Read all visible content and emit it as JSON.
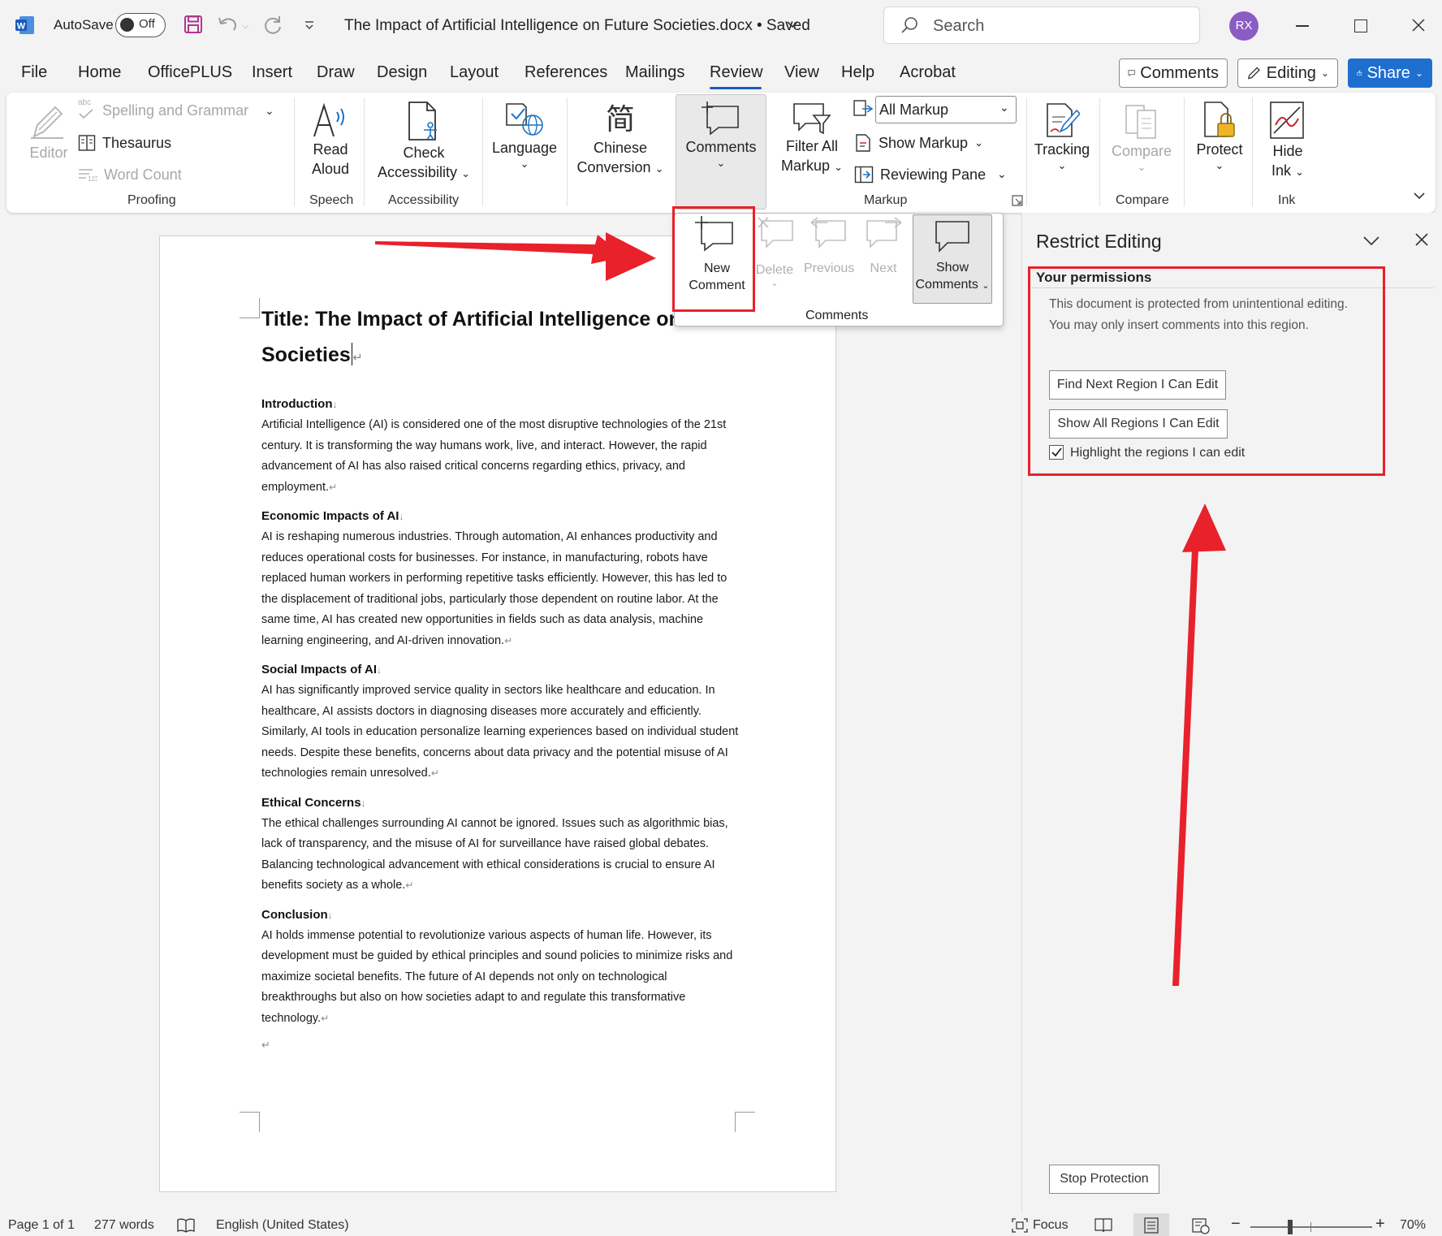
{
  "titlebar": {
    "autosave_label": "AutoSave",
    "autosave_state": "Off",
    "doc_title": "The Impact of Artificial Intelligence on Future Societies.docx • Saved",
    "search_placeholder": "Search",
    "avatar_initials": "RX"
  },
  "menu": {
    "tabs": [
      "File",
      "Home",
      "OfficePLUS",
      "Insert",
      "Draw",
      "Design",
      "Layout",
      "References",
      "Mailings",
      "Review",
      "View",
      "Help",
      "Acrobat"
    ],
    "active_tab": "Review",
    "comments_btn": "Comments",
    "editing_btn": "Editing",
    "share_btn": "Share"
  },
  "ribbon": {
    "editor": "Editor",
    "spelling": "Spelling and Grammar",
    "spelling_abc": "abc",
    "thesaurus": "Thesaurus",
    "word_count": "Word Count",
    "proofing": "Proofing",
    "read": "Read",
    "aloud": "Aloud",
    "speech": "Speech",
    "check": "Check",
    "accessibility_btn": "Accessibility",
    "accessibility_group": "Accessibility",
    "language": "Language",
    "chinese": "Chinese",
    "conversion": "Conversion",
    "comments": "Comments",
    "filter_all": "Filter All",
    "markup_btn": "Markup",
    "all_markup": "All Markup",
    "show_markup": "Show Markup",
    "reviewing_pane": "Reviewing Pane",
    "markup_group": "Markup",
    "tracking": "Tracking",
    "compare_btn": "Compare",
    "compare_group": "Compare",
    "protect": "Protect",
    "hide": "Hide",
    "ink_btn": "Ink",
    "ink_group": "Ink"
  },
  "comments_popup": {
    "new_line1": "New",
    "new_line2": "Comment",
    "delete": "Delete",
    "previous": "Previous",
    "next": "Next",
    "show_line1": "Show",
    "show_line2": "Comments",
    "group": "Comments"
  },
  "document": {
    "title_line1": "Title: The Impact of Artificial Intelligence on Future",
    "title_line2": "Societies",
    "sections": [
      {
        "heading": "Introduction",
        "lines": [
          "Artificial Intelligence (AI) is considered one of the most disruptive technologies of the 21st",
          "century. It is transforming the way humans work, live, and interact. However, the rapid",
          "advancement of AI has also raised critical concerns regarding ethics, privacy, and",
          "employment."
        ]
      },
      {
        "heading": "Economic Impacts of AI",
        "lines": [
          "AI is reshaping numerous industries. Through automation, AI enhances productivity and",
          "reduces operational costs for businesses. For instance, in manufacturing, robots have",
          "replaced human workers in performing repetitive tasks efficiently. However, this has led to",
          "the displacement of traditional jobs, particularly those dependent on routine labor. At the",
          "same time, AI has created new opportunities in fields such as data analysis, machine",
          "learning engineering, and AI-driven innovation."
        ]
      },
      {
        "heading": "Social Impacts of AI",
        "lines": [
          "AI has significantly improved service quality in sectors like healthcare and education. In",
          "healthcare, AI assists doctors in diagnosing diseases more accurately and efficiently.",
          "Similarly, AI tools in education personalize learning experiences based on individual student",
          "needs. Despite these benefits, concerns about data privacy and the potential misuse of AI",
          "technologies remain unresolved."
        ]
      },
      {
        "heading": "Ethical Concerns",
        "lines": [
          "The ethical challenges surrounding AI cannot be ignored. Issues such as algorithmic bias,",
          "lack of transparency, and the misuse of AI for surveillance have raised global debates.",
          "Balancing technological advancement with ethical considerations is crucial to ensure AI",
          "benefits society as a whole."
        ]
      },
      {
        "heading": "Conclusion",
        "lines": [
          "AI holds immense potential to revolutionize various aspects of human life. However, its",
          "development must be guided by ethical principles and sound policies to minimize risks and",
          "maximize societal benefits. The future of AI depends not only on technological",
          "breakthroughs but also on how societies adapt to and regulate this transformative",
          "technology."
        ]
      }
    ],
    "line_break_mark": "↓",
    "paragraph_mark": "↵"
  },
  "restrict_pane": {
    "title": "Restrict Editing",
    "permissions_heading": "Your permissions",
    "info_line1": "This document is protected from unintentional editing.",
    "info_line2": "You may only insert comments into this region.",
    "find_next_btn": "Find Next Region I Can Edit",
    "show_all_btn": "Show All Regions I Can Edit",
    "highlight_label": "Highlight the regions I can edit",
    "highlight_checked": true,
    "stop_btn": "Stop Protection"
  },
  "statusbar": {
    "page": "Page 1 of 1",
    "words": "277 words",
    "language": "English (United States)",
    "focus": "Focus",
    "zoom_minus": "−",
    "zoom_plus": "+",
    "zoom": "70%"
  },
  "colors": {
    "accent": "#1a5fb4",
    "share": "#1f6fd1",
    "annotation_red": "#e8212b",
    "avatar": "#8b5cc4",
    "word_blue": "#185abd"
  }
}
